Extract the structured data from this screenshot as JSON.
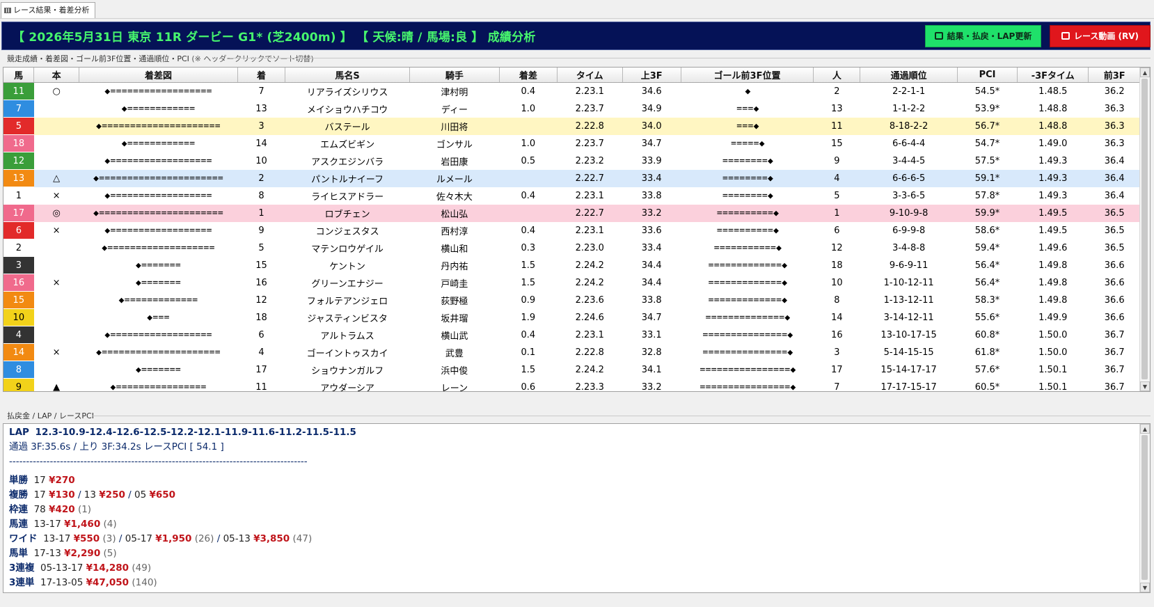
{
  "tab": {
    "label": "レース結果・着差分析"
  },
  "banner": {
    "title": "【 2026年5月31日 東京 11R ダービー G1* (芝2400m) 】 【 天候:晴 / 馬場:良 】 成績分析",
    "update_button": "結果・払戻・LAP更新",
    "video_button": "レース動画 (RV)",
    "update_color": "#1fe06a",
    "video_color": "#e0161c"
  },
  "grid_section": {
    "label": "競走成績・着差図・ゴール前3F位置・通過順位・PCI",
    "note": "(※ ヘッダークリックでソート切替)"
  },
  "columns": [
    "馬",
    "本",
    "着差図",
    "着",
    "馬名S",
    "騎手",
    "着差",
    "タイム",
    "上3F",
    "ゴール前3F位置",
    "人",
    "通過順位",
    "PCI",
    "-3Fタイム",
    "前3F"
  ],
  "rows": [
    {
      "num": "11",
      "num_bg": "#3a9e3a",
      "num_fg": "#ffffff",
      "mark": "○",
      "chakusa": "◆==================",
      "rank": "7",
      "horse": "リアライズシリウス",
      "jockey": "津村明",
      "margin": "0.4",
      "time": "2.23.1",
      "last3f": "34.6",
      "goal": "◆",
      "pop": "2",
      "passing": "2-2-1-1",
      "pci": "54.5*",
      "m3f": "1.48.5",
      "f3f": "36.2",
      "hl": ""
    },
    {
      "num": "7",
      "num_bg": "#2f8de0",
      "num_fg": "#ffffff",
      "mark": "",
      "chakusa": "◆============",
      "rank": "13",
      "horse": "メイショウハチコウ",
      "jockey": "ディー",
      "margin": "1.0",
      "time": "2.23.7",
      "last3f": "34.9",
      "goal": "===◆",
      "pop": "13",
      "passing": "1-1-2-2",
      "pci": "53.9*",
      "m3f": "1.48.8",
      "f3f": "36.3",
      "hl": ""
    },
    {
      "num": "5",
      "num_bg": "#e22a2a",
      "num_fg": "#ffffff",
      "mark": "",
      "chakusa": "◆=====================",
      "rank": "3",
      "horse": "バステール",
      "jockey": "川田将",
      "margin": "",
      "time": "2.22.8",
      "last3f": "34.0",
      "goal": "===◆",
      "pop": "11",
      "passing": "8-18-2-2",
      "pci": "56.7*",
      "m3f": "1.48.8",
      "f3f": "36.3",
      "hl": "yellow"
    },
    {
      "num": "18",
      "num_bg": "#f06a8c",
      "num_fg": "#ffffff",
      "mark": "",
      "chakusa": "◆============",
      "rank": "14",
      "horse": "エムズビギン",
      "jockey": "ゴンサル",
      "margin": "1.0",
      "time": "2.23.7",
      "last3f": "34.7",
      "goal": "=====◆",
      "pop": "15",
      "passing": "6-6-4-4",
      "pci": "54.7*",
      "m3f": "1.49.0",
      "f3f": "36.3",
      "hl": ""
    },
    {
      "num": "12",
      "num_bg": "#3a9e3a",
      "num_fg": "#ffffff",
      "mark": "",
      "chakusa": "◆==================",
      "rank": "10",
      "horse": "アスクエジンバラ",
      "jockey": "岩田康",
      "margin": "0.5",
      "time": "2.23.2",
      "last3f": "33.9",
      "goal": "========◆",
      "pop": "9",
      "passing": "3-4-4-5",
      "pci": "57.5*",
      "m3f": "1.49.3",
      "f3f": "36.4",
      "hl": ""
    },
    {
      "num": "13",
      "num_bg": "#f28a12",
      "num_fg": "#ffffff",
      "mark": "△",
      "chakusa": "◆======================",
      "rank": "2",
      "horse": "パントルナイーフ",
      "jockey": "ルメール",
      "margin": "",
      "time": "2.22.7",
      "last3f": "33.4",
      "goal": "========◆",
      "pop": "4",
      "passing": "6-6-6-5",
      "pci": "59.1*",
      "m3f": "1.49.3",
      "f3f": "36.4",
      "hl": "blue"
    },
    {
      "num": "1",
      "num_bg": "#ffffff",
      "num_fg": "#000000",
      "mark": "×",
      "chakusa": "◆==================",
      "rank": "8",
      "horse": "ライヒスアドラー",
      "jockey": "佐々木大",
      "margin": "0.4",
      "time": "2.23.1",
      "last3f": "33.8",
      "goal": "========◆",
      "pop": "5",
      "passing": "3-3-6-5",
      "pci": "57.8*",
      "m3f": "1.49.3",
      "f3f": "36.4",
      "hl": ""
    },
    {
      "num": "17",
      "num_bg": "#f06a8c",
      "num_fg": "#ffffff",
      "mark": "◎",
      "chakusa": "◆======================",
      "rank": "1",
      "horse": "ロブチェン",
      "jockey": "松山弘",
      "margin": "",
      "time": "2.22.7",
      "last3f": "33.2",
      "goal": "==========◆",
      "pop": "1",
      "passing": "9-10-9-8",
      "pci": "59.9*",
      "m3f": "1.49.5",
      "f3f": "36.5",
      "hl": "pink"
    },
    {
      "num": "6",
      "num_bg": "#e22a2a",
      "num_fg": "#ffffff",
      "mark": "×",
      "chakusa": "◆==================",
      "rank": "9",
      "horse": "コンジェスタス",
      "jockey": "西村淳",
      "margin": "0.4",
      "time": "2.23.1",
      "last3f": "33.6",
      "goal": "==========◆",
      "pop": "6",
      "passing": "6-9-9-8",
      "pci": "58.6*",
      "m3f": "1.49.5",
      "f3f": "36.5",
      "hl": ""
    },
    {
      "num": "2",
      "num_bg": "#ffffff",
      "num_fg": "#000000",
      "mark": "",
      "chakusa": "◆===================",
      "rank": "5",
      "horse": "マテンロウゲイル",
      "jockey": "横山和",
      "margin": "0.3",
      "time": "2.23.0",
      "last3f": "33.4",
      "goal": "===========◆",
      "pop": "12",
      "passing": "3-4-8-8",
      "pci": "59.4*",
      "m3f": "1.49.6",
      "f3f": "36.5",
      "hl": ""
    },
    {
      "num": "3",
      "num_bg": "#333333",
      "num_fg": "#ffffff",
      "mark": "",
      "chakusa": "◆=======",
      "rank": "15",
      "horse": "ケントン",
      "jockey": "丹内祐",
      "margin": "1.5",
      "time": "2.24.2",
      "last3f": "34.4",
      "goal": "=============◆",
      "pop": "18",
      "passing": "9-6-9-11",
      "pci": "56.4*",
      "m3f": "1.49.8",
      "f3f": "36.6",
      "hl": ""
    },
    {
      "num": "16",
      "num_bg": "#f06a8c",
      "num_fg": "#ffffff",
      "mark": "×",
      "chakusa": "◆=======",
      "rank": "16",
      "horse": "グリーンエナジー",
      "jockey": "戸崎圭",
      "margin": "1.5",
      "time": "2.24.2",
      "last3f": "34.4",
      "goal": "=============◆",
      "pop": "10",
      "passing": "1-10-12-11",
      "pci": "56.4*",
      "m3f": "1.49.8",
      "f3f": "36.6",
      "hl": ""
    },
    {
      "num": "15",
      "num_bg": "#f28a12",
      "num_fg": "#ffffff",
      "mark": "",
      "chakusa": "◆=============",
      "rank": "12",
      "horse": "フォルテアンジェロ",
      "jockey": "荻野極",
      "margin": "0.9",
      "time": "2.23.6",
      "last3f": "33.8",
      "goal": "=============◆",
      "pop": "8",
      "passing": "1-13-12-11",
      "pci": "58.3*",
      "m3f": "1.49.8",
      "f3f": "36.6",
      "hl": ""
    },
    {
      "num": "10",
      "num_bg": "#f2d21a",
      "num_fg": "#000000",
      "mark": "",
      "chakusa": "◆===",
      "rank": "18",
      "horse": "ジャスティンビスタ",
      "jockey": "坂井瑠",
      "margin": "1.9",
      "time": "2.24.6",
      "last3f": "34.7",
      "goal": "==============◆",
      "pop": "14",
      "passing": "3-14-12-11",
      "pci": "55.6*",
      "m3f": "1.49.9",
      "f3f": "36.6",
      "hl": ""
    },
    {
      "num": "4",
      "num_bg": "#333333",
      "num_fg": "#ffffff",
      "mark": "",
      "chakusa": "◆==================",
      "rank": "6",
      "horse": "アルトラムス",
      "jockey": "横山武",
      "margin": "0.4",
      "time": "2.23.1",
      "last3f": "33.1",
      "goal": "===============◆",
      "pop": "16",
      "passing": "13-10-17-15",
      "pci": "60.8*",
      "m3f": "1.50.0",
      "f3f": "36.7",
      "hl": ""
    },
    {
      "num": "14",
      "num_bg": "#f28a12",
      "num_fg": "#ffffff",
      "mark": "×",
      "chakusa": "◆=====================",
      "rank": "4",
      "horse": "ゴーイントゥスカイ",
      "jockey": "武豊",
      "margin": "0.1",
      "time": "2.22.8",
      "last3f": "32.8",
      "goal": "===============◆",
      "pop": "3",
      "passing": "5-14-15-15",
      "pci": "61.8*",
      "m3f": "1.50.0",
      "f3f": "36.7",
      "hl": ""
    },
    {
      "num": "8",
      "num_bg": "#2f8de0",
      "num_fg": "#ffffff",
      "mark": "",
      "chakusa": "◆=======",
      "rank": "17",
      "horse": "ショウナンガルフ",
      "jockey": "浜中俊",
      "margin": "1.5",
      "time": "2.24.2",
      "last3f": "34.1",
      "goal": "================◆",
      "pop": "17",
      "passing": "15-14-17-17",
      "pci": "57.6*",
      "m3f": "1.50.1",
      "f3f": "36.7",
      "hl": ""
    },
    {
      "num": "9",
      "num_bg": "#f2d21a",
      "num_fg": "#000000",
      "mark": "▲",
      "chakusa": "◆================",
      "rank": "11",
      "horse": "アウダーシア",
      "jockey": "レーン",
      "margin": "0.6",
      "time": "2.23.3",
      "last3f": "33.2",
      "goal": "================◆",
      "pop": "7",
      "passing": "17-17-15-17",
      "pci": "60.5*",
      "m3f": "1.50.1",
      "f3f": "36.7",
      "hl": ""
    }
  ],
  "pay_section": {
    "label": "払戻金 / LAP / レースPCI"
  },
  "lap": {
    "label": "LAP",
    "values": "12.3-10.9-12.4-12.6-12.5-12.2-12.1-11.9-11.6-11.2-11.5-11.5",
    "pace": "通過 3F:35.6s / 上り 3F:34.2s レースPCI [ 54.1 ]",
    "divider": "----------------------------------------------------------------------------------------"
  },
  "payouts": [
    {
      "label": "単勝",
      "parts": [
        {
          "comb": "17",
          "yen": "¥270",
          "pop": ""
        }
      ]
    },
    {
      "label": "複勝",
      "parts": [
        {
          "comb": "17",
          "yen": "¥130",
          "pop": ""
        },
        {
          "comb": "13",
          "yen": "¥250",
          "pop": ""
        },
        {
          "comb": "05",
          "yen": "¥650",
          "pop": ""
        }
      ]
    },
    {
      "label": "枠連",
      "parts": [
        {
          "comb": "78",
          "yen": "¥420",
          "pop": "(1)"
        }
      ]
    },
    {
      "label": "馬連",
      "parts": [
        {
          "comb": "13-17",
          "yen": "¥1,460",
          "pop": "(4)"
        }
      ]
    },
    {
      "label": "ワイド",
      "parts": [
        {
          "comb": "13-17",
          "yen": "¥550",
          "pop": "(3)"
        },
        {
          "comb": "05-17",
          "yen": "¥1,950",
          "pop": "(26)"
        },
        {
          "comb": "05-13",
          "yen": "¥3,850",
          "pop": "(47)"
        }
      ]
    },
    {
      "label": "馬単",
      "parts": [
        {
          "comb": "17-13",
          "yen": "¥2,290",
          "pop": "(5)"
        }
      ]
    },
    {
      "label": "3連複",
      "parts": [
        {
          "comb": "05-13-17",
          "yen": "¥14,280",
          "pop": "(49)"
        }
      ]
    },
    {
      "label": "3連単",
      "parts": [
        {
          "comb": "17-13-05",
          "yen": "¥47,050",
          "pop": "(140)"
        }
      ]
    }
  ]
}
